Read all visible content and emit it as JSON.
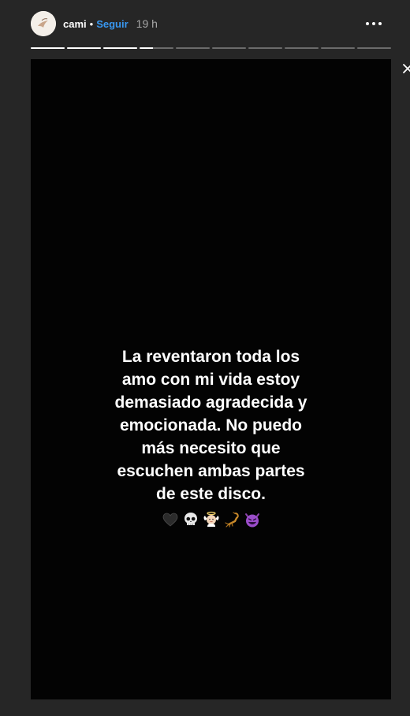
{
  "header": {
    "username": "cami",
    "separator": "•",
    "follow_label": "Seguir",
    "time": "19 h",
    "more_icon": "more-horizontal-icon",
    "avatar_icon": "avatar"
  },
  "progress": {
    "segments": [
      1,
      1,
      1,
      0.4,
      0,
      0,
      0,
      0,
      0,
      0
    ]
  },
  "story": {
    "lines": [
      "La reventaron toda los",
      "amo con mi vida estoy",
      "demasiado agradecida y",
      "emocionada. No puedo",
      "más necesito que",
      "escuchen ambas partes",
      "de este disco."
    ],
    "emojis": [
      "black-heart-icon",
      "skull-icon",
      "baby-angel-icon",
      "scorpion-icon",
      "smiling-imp-icon"
    ]
  },
  "close_icon": "close-icon",
  "colors": {
    "background": "#262626",
    "story_background": "#030303",
    "follow": "#3897f0",
    "time": "#a8a8a8"
  }
}
